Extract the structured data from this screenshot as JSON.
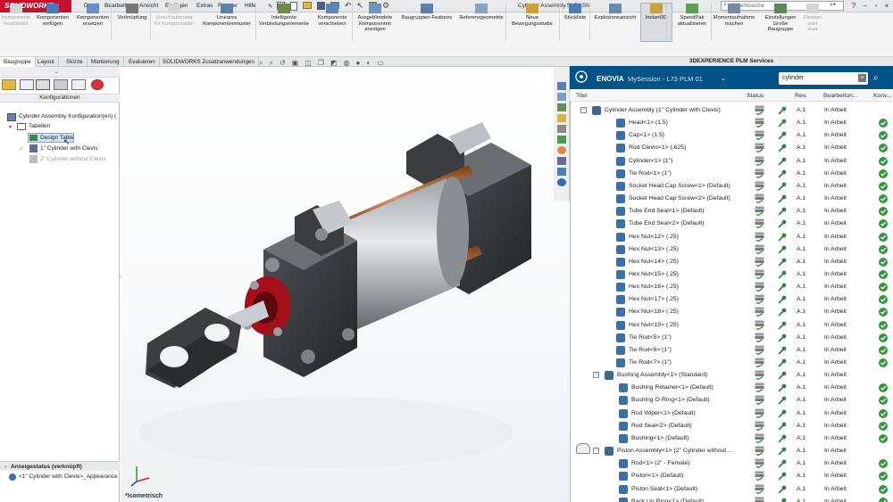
{
  "app": {
    "logo": "SOLIDWORKS",
    "window_title": "Cylinder Assembly.SLDASM",
    "search_placeholder": "Befehlssuche"
  },
  "menu": [
    "Datei",
    "Bearbeiten",
    "Ansicht",
    "Einfügen",
    "Extras",
    "Fenster",
    "Hilfe"
  ],
  "ribbon": [
    {
      "label": "Komponente bearbeiten",
      "disabled": true
    },
    {
      "label": "Komponenten einfügen",
      "disabled": false
    },
    {
      "label": "Komponenten ersetzen",
      "disabled": false
    },
    {
      "label": "Verknüpfung",
      "disabled": false
    },
    {
      "label": "Vorschaufenster für Komponenten",
      "disabled": true
    },
    {
      "label": "Lineares Komponentenmuster",
      "disabled": false
    },
    {
      "label": "Intelligente Verbindungselemente",
      "disabled": false
    },
    {
      "label": "Komponente verschieben",
      "disabled": false
    },
    {
      "label": "Ausgeblendete Komponenten anzeigen",
      "disabled": false
    },
    {
      "label": "Baugruppen-Features",
      "disabled": false
    },
    {
      "label": "Referenzgeometrie",
      "disabled": false
    },
    {
      "label": "Neue Bewegungsstudie",
      "disabled": false
    },
    {
      "label": "Stückliste",
      "disabled": false
    },
    {
      "label": "Explosionsansicht",
      "disabled": false
    },
    {
      "label": "Instant3D",
      "disabled": false
    },
    {
      "label": "SpeedPak aktualisieren",
      "disabled": false
    },
    {
      "label": "Momentaufnahme machen",
      "disabled": false
    },
    {
      "label": "Einstellungen Große Baugruppe",
      "disabled": false
    },
    {
      "label": "Flexibel oder starr",
      "disabled": true
    }
  ],
  "tabs": [
    "Baugruppe",
    "Layout",
    "Skizze",
    "Markierung",
    "Evaluieren",
    "SOLIDWORKS Zusatzanwendungen"
  ],
  "left": {
    "panel_title": "Konfigurationen",
    "root": "Cylinder Assembly Konfiguration(en)  (",
    "tables": "Tabellen",
    "design_table": "Design Table",
    "config1": "1\" Cylinder with Clevis",
    "config2": "2\" Cylinder without Clevis",
    "display_state_header": "Anzeigestatus (verknüpft)",
    "display_state": "<1\" Cylinder with Clevis>_Appearance"
  },
  "viewport": {
    "view_label": "*Isometrisch"
  },
  "plm": {
    "header": "3DEXPERIENCE PLM Services",
    "brand": "ENOVIA",
    "session": "MySession - L73 PLM 01",
    "search_value": "cylinder",
    "columns": [
      "Titel",
      "Status",
      "Rev.",
      "Bearbeitun...",
      "Konv..."
    ],
    "rows": [
      {
        "t": "Cylinder Assembly (1\" Cylinder with Clevis)",
        "lvl": 0,
        "tog": "−",
        "rev": "A.1",
        "bea": "In Arbeit",
        "ok": false,
        "asm": true
      },
      {
        "t": "Head<1> (1.5)",
        "lvl": 1,
        "rev": "A.1",
        "bea": "In Arbeit",
        "ok": true
      },
      {
        "t": "Cap<1> (1.5)",
        "lvl": 1,
        "rev": "A.1",
        "bea": "In Arbeit",
        "ok": true
      },
      {
        "t": "Rod Clevis<1> (.625)",
        "lvl": 1,
        "rev": "A.1",
        "bea": "In Arbeit",
        "ok": true
      },
      {
        "t": "Cylinder<1> (1\")",
        "lvl": 1,
        "rev": "A.1",
        "bea": "In Arbeit",
        "ok": true
      },
      {
        "t": "Tie Rod<1> (1\")",
        "lvl": 1,
        "rev": "A.1",
        "bea": "In Arbeit",
        "ok": true
      },
      {
        "t": "Socket Head Cap Screw<1> (Default)",
        "lvl": 1,
        "rev": "A.1",
        "bea": "In Arbeit",
        "ok": true
      },
      {
        "t": "Socket Head Cap Screw<2> (Default)",
        "lvl": 1,
        "rev": "A.1",
        "bea": "In Arbeit",
        "ok": true
      },
      {
        "t": "Tube End Seal<1> (Default)",
        "lvl": 1,
        "rev": "A.1",
        "bea": "In Arbeit",
        "ok": true
      },
      {
        "t": "Tube End Seal<2> (Default)",
        "lvl": 1,
        "rev": "A.1",
        "bea": "In Arbeit",
        "ok": true
      },
      {
        "t": "Hex Nut<12> (.25)",
        "lvl": 1,
        "rev": "A.1",
        "bea": "In Arbeit",
        "ok": true
      },
      {
        "t": "Hex Nut<13> (.25)",
        "lvl": 1,
        "rev": "A.1",
        "bea": "In Arbeit",
        "ok": true
      },
      {
        "t": "Hex Nut<14> (.25)",
        "lvl": 1,
        "rev": "A.1",
        "bea": "In Arbeit",
        "ok": true
      },
      {
        "t": "Hex Nut<15> (.25)",
        "lvl": 1,
        "rev": "A.1",
        "bea": "In Arbeit",
        "ok": true
      },
      {
        "t": "Hex Nut<16> (.25)",
        "lvl": 1,
        "rev": "A.1",
        "bea": "In Arbeit",
        "ok": true
      },
      {
        "t": "Hex Nut<17> (.25)",
        "lvl": 1,
        "rev": "A.1",
        "bea": "In Arbeit",
        "ok": true
      },
      {
        "t": "Hex Nut<18> (.25)",
        "lvl": 1,
        "rev": "A.1",
        "bea": "In Arbeit",
        "ok": true
      },
      {
        "t": "Hex Nut<19> (.25)",
        "lvl": 1,
        "rev": "A.1",
        "bea": "In Arbeit",
        "ok": true
      },
      {
        "t": "Tie Rod<5> (1\")",
        "lvl": 1,
        "rev": "A.1",
        "bea": "In Arbeit",
        "ok": true
      },
      {
        "t": "Tie Rod<6> (1\")",
        "lvl": 1,
        "rev": "A.1",
        "bea": "In Arbeit",
        "ok": true
      },
      {
        "t": "Tie Rod<7> (1\")",
        "lvl": 1,
        "rev": "A.1",
        "bea": "In Arbeit",
        "ok": true
      },
      {
        "t": "Bushing Assembly<1> (Standard)",
        "lvl": 1,
        "tog": "−",
        "rev": "A.1",
        "bea": "In Arbeit",
        "ok": false,
        "asm": true
      },
      {
        "t": "Bushing Retainer<1> (Default)",
        "lvl": 2,
        "rev": "A.1",
        "bea": "In Arbeit",
        "ok": true
      },
      {
        "t": "Bushing O-Ring<1> (Default)",
        "lvl": 2,
        "rev": "A.1",
        "bea": "In Arbeit",
        "ok": true
      },
      {
        "t": "Rod Wiper<1> (Default)",
        "lvl": 2,
        "rev": "A.1",
        "bea": "In Arbeit",
        "ok": true
      },
      {
        "t": "Rod Seal<2> (Default)",
        "lvl": 2,
        "rev": "A.1",
        "bea": "In Arbeit",
        "ok": true
      },
      {
        "t": "Bushing<1> (Default)",
        "lvl": 2,
        "rev": "A.1",
        "bea": "In Arbeit",
        "ok": true
      },
      {
        "t": "Piston Assembly<1> (2\" Cylinder without ...",
        "lvl": 1,
        "tog": "−",
        "rev": "A.1",
        "bea": "In Arbeit",
        "ok": false,
        "asm": true
      },
      {
        "t": "Rod<1> (2\" - Female)",
        "lvl": 2,
        "rev": "A.1",
        "bea": "In Arbeit",
        "ok": true
      },
      {
        "t": "Piston<1> (Default)",
        "lvl": 2,
        "rev": "A.1",
        "bea": "In Arbeit",
        "ok": true
      },
      {
        "t": "Piston Seal<1> (Default)",
        "lvl": 2,
        "rev": "A.1",
        "bea": "In Arbeit",
        "ok": true
      },
      {
        "t": "Back Up Ring<1> (Default)",
        "lvl": 2,
        "rev": "A.1",
        "bea": "In Arbeit",
        "ok": true
      }
    ]
  },
  "colors": {
    "brand_red": "#c8102e",
    "enovia_blue": "#005386",
    "ok_green": "#2f9a3a"
  }
}
